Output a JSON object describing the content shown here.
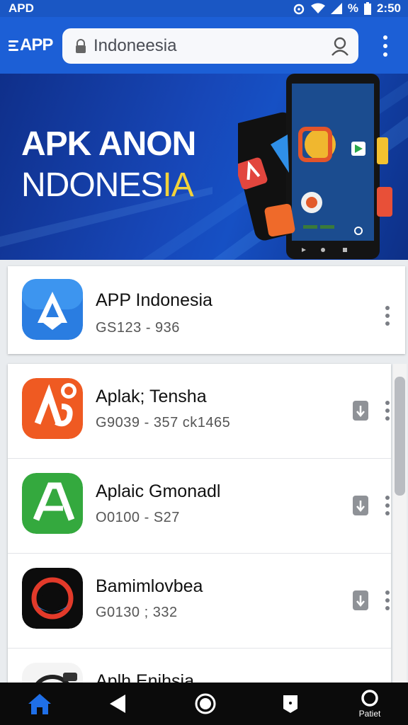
{
  "status_bar": {
    "carrier": "APD",
    "battery": "%",
    "time": "2:50"
  },
  "app_bar": {
    "logo_text": "APP",
    "search_value": "Indoneesia"
  },
  "banner": {
    "line1": "APK ANON",
    "line2_main": "NDONES",
    "line2_accent": "IA"
  },
  "featured": {
    "title": "APP Indonesia",
    "subtitle": "GS123 - 936"
  },
  "apps": [
    {
      "title": "Aplak; Tensha",
      "subtitle": "G9039 - 357  ck1465"
    },
    {
      "title": "Aplaic Gmonadl",
      "subtitle": "O0100 - S27"
    },
    {
      "title": "Bamimlovbea",
      "subtitle": "G0130 ; 332"
    },
    {
      "title": "Aplh Enihsia",
      "subtitle": ""
    }
  ],
  "nav": {
    "last_label": "Patiet"
  },
  "colors": {
    "primary": "#1c5fd6",
    "accent": "#f2d23a",
    "nav_bg": "#0b0b0b"
  }
}
